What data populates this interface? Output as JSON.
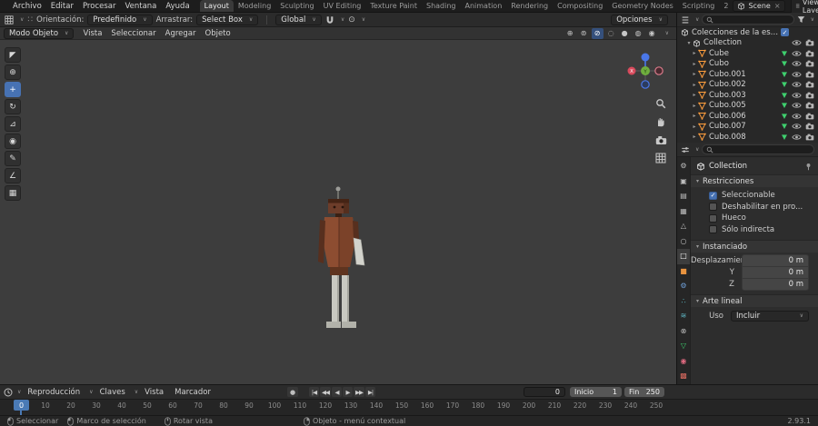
{
  "glyphs": {
    "chevron": "∨",
    "open": "▾",
    "closed": "▸",
    "check": "✓",
    "close": "×",
    "grip": "∷",
    "proportional": "⊙",
    "record": "●"
  },
  "colors": {
    "accent": "#4772b3",
    "mesh_orange": "#ff9e3d",
    "data_green": "#3fcf6e"
  },
  "topbar": {
    "menus": [
      "Archivo",
      "Editar",
      "Procesar",
      "Ventana",
      "Ayuda"
    ],
    "tabs": [
      "Layout",
      "Modeling",
      "Sculpting",
      "UV Editing",
      "Texture Paint",
      "Shading",
      "Animation",
      "Rendering",
      "Compositing",
      "Geometry Nodes",
      "Scripting"
    ],
    "active_tab": "Layout",
    "extra_tab": "2",
    "scene_label": "Scene",
    "view_layer_label": "View Layer"
  },
  "tool_settings": {
    "orientation_label": "Orientación:",
    "orientation_value": "Predefinido",
    "drag_label": "Arrastrar:",
    "drag_value": "Select Box",
    "pivot_value": "Global",
    "options_label": "Opciones"
  },
  "viewport": {
    "mode": "Modo Objeto",
    "menus": [
      "Vista",
      "Seleccionar",
      "Agregar",
      "Objeto"
    ],
    "axis_x": "X",
    "axis_y": "Y",
    "tools": [
      {
        "name": "select-box-tool",
        "glyph": "◤",
        "active": false
      },
      {
        "name": "cursor-tool",
        "glyph": "⊕",
        "active": false
      },
      {
        "name": "move-tool",
        "glyph": "+",
        "active": true
      },
      {
        "name": "rotate-tool",
        "glyph": "↻",
        "active": false
      },
      {
        "name": "scale-tool",
        "glyph": "⊿",
        "active": false
      },
      {
        "name": "transform-tool",
        "glyph": "◉",
        "active": false
      },
      {
        "name": "annotate-tool",
        "glyph": "✎",
        "active": false
      },
      {
        "name": "measure-tool",
        "glyph": "∠",
        "active": false
      },
      {
        "name": "add-cube-tool",
        "glyph": "▦",
        "active": false
      }
    ],
    "right_icons": [
      {
        "name": "gizmos-toggle-icon",
        "glyph": "⊕",
        "active": false
      },
      {
        "name": "overlays-toggle-icon",
        "glyph": "⊚",
        "active": false
      },
      {
        "name": "xray-toggle-icon",
        "glyph": "⊘",
        "active": true
      },
      {
        "name": "shading-wireframe-icon",
        "glyph": "◌",
        "active": false
      },
      {
        "name": "shading-solid-icon",
        "glyph": "●",
        "active": false
      },
      {
        "name": "shading-material-icon",
        "glyph": "◍",
        "active": false
      },
      {
        "name": "shading-rendered-icon",
        "glyph": "◉",
        "active": false
      }
    ]
  },
  "outliner": {
    "root_label": "Colecciones de la escena",
    "collection_label": "Collection",
    "items": [
      "Cube",
      "Cubo",
      "Cubo.001",
      "Cubo.002",
      "Cubo.003",
      "Cubo.005",
      "Cubo.006",
      "Cubo.007",
      "Cubo.008"
    ]
  },
  "properties": {
    "collection_name": "Collection",
    "tabs": [
      {
        "name": "tool-tab",
        "glyph": "⚙",
        "color": "#bdbdbd",
        "active": false
      },
      {
        "name": "render-tab",
        "glyph": "▣",
        "color": "#bdbdbd",
        "active": false
      },
      {
        "name": "output-tab",
        "glyph": "▤",
        "color": "#bdbdbd",
        "active": false
      },
      {
        "name": "view-layer-tab",
        "glyph": "▦",
        "color": "#bdbdbd",
        "active": false
      },
      {
        "name": "scene-tab",
        "glyph": "△",
        "color": "#bdbdbd",
        "active": false
      },
      {
        "name": "world-tab",
        "glyph": "○",
        "color": "#bdbdbd",
        "active": false
      },
      {
        "name": "collection-tab",
        "glyph": "□",
        "color": "#ffffff",
        "active": true
      },
      {
        "name": "object-tab",
        "glyph": "■",
        "color": "#e8933f",
        "active": false
      },
      {
        "name": "modifiers-tab",
        "glyph": "⚙",
        "color": "#6f9fd8",
        "active": false
      },
      {
        "name": "particles-tab",
        "glyph": "∴",
        "color": "#5fb7c4",
        "active": false
      },
      {
        "name": "physics-tab",
        "glyph": "≋",
        "color": "#5fb7c4",
        "active": false
      },
      {
        "name": "constraints-tab",
        "glyph": "⊗",
        "color": "#bdbdbd",
        "active": false
      },
      {
        "name": "data-tab",
        "glyph": "▽",
        "color": "#3fcf6e",
        "active": false
      },
      {
        "name": "material-tab",
        "glyph": "◉",
        "color": "#e06a80",
        "active": false
      },
      {
        "name": "texture-tab",
        "glyph": "▩",
        "color": "#d86a5f",
        "active": false
      }
    ],
    "restricciones": {
      "title": "Restricciones",
      "checkboxes": [
        {
          "label": "Seleccionable",
          "checked": true
        },
        {
          "label": "Deshabilitar en pro...",
          "checked": false
        },
        {
          "label": "Hueco",
          "checked": false
        },
        {
          "label": "Sólo indirecta",
          "checked": false
        }
      ]
    },
    "instanciado": {
      "title": "Instanciado",
      "rows": [
        {
          "label": "Desplazamient...",
          "value": "0 m"
        },
        {
          "label": "Y",
          "value": "0 m"
        },
        {
          "label": "Z",
          "value": "0 m"
        }
      ]
    },
    "arte_lineal": {
      "title": "Arte lineal",
      "uso_label": "Uso",
      "uso_value": "Incluir"
    }
  },
  "timeline": {
    "menu_playback": "Reproducción",
    "menu_keys": "Claves",
    "menu_view": "Vista",
    "menu_marker": "Marcador",
    "transport": [
      {
        "name": "jump-start-button",
        "glyph": "|◀"
      },
      {
        "name": "prev-keyframe-button",
        "glyph": "◀◀"
      },
      {
        "name": "play-reverse-button",
        "glyph": "◀"
      },
      {
        "name": "play-button",
        "glyph": "▶"
      },
      {
        "name": "next-keyframe-button",
        "glyph": "▶▶"
      },
      {
        "name": "jump-end-button",
        "glyph": "▶|"
      }
    ],
    "frame_current": "0",
    "start_label": "Inicio",
    "start_value": "1",
    "end_label": "Fin",
    "end_value": "250",
    "playhead": "0",
    "ticks": [
      "0",
      "10",
      "20",
      "30",
      "40",
      "50",
      "60",
      "70",
      "80",
      "90",
      "100",
      "110",
      "120",
      "130",
      "140",
      "150",
      "160",
      "170",
      "180",
      "190",
      "200",
      "210",
      "220",
      "230",
      "240",
      "250"
    ]
  },
  "statusbar": {
    "items": [
      {
        "icon": "#sym-mouse-left",
        "icon_name": "left-mouse-icon",
        "label": "Seleccionar",
        "ml": "0px"
      },
      {
        "icon": "#sym-mouse-left",
        "icon_name": "left-mouse-drag-icon",
        "label": "Marco de selección",
        "ml": "10px"
      },
      {
        "icon": "#sym-mouse-middle",
        "icon_name": "middle-mouse-icon",
        "label": "Rotar vista",
        "ml": "20px"
      },
      {
        "icon": "#sym-mouse-right",
        "icon_name": "right-mouse-icon",
        "label": "Objeto - menú contextual",
        "ml": "100px"
      }
    ],
    "version": "2.93.1"
  }
}
